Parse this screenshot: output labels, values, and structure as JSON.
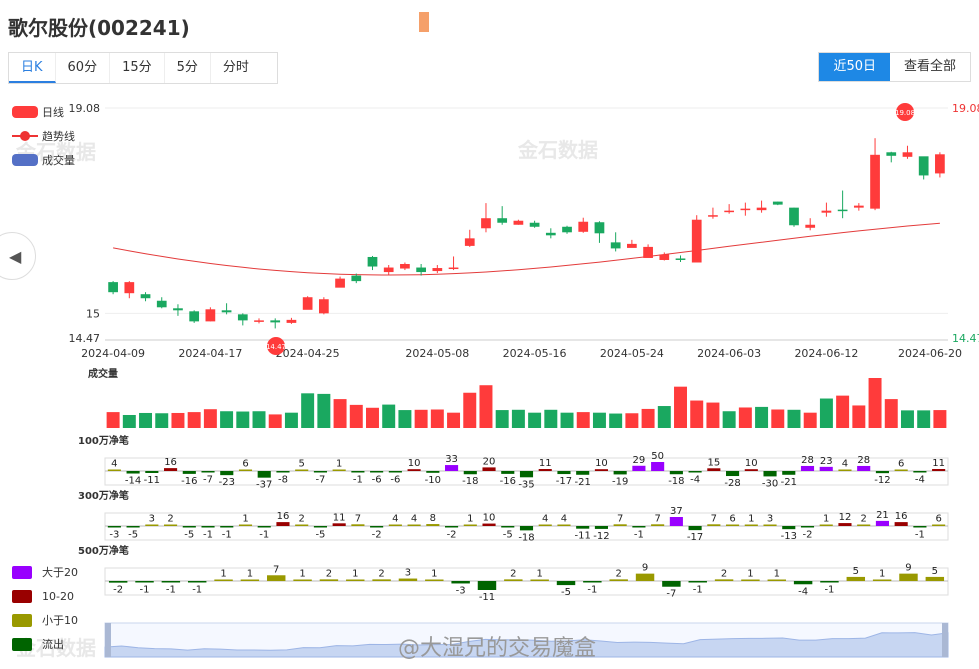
{
  "title": "歌尔股份(002241)",
  "tabs": [
    {
      "label": "日K",
      "active": true
    },
    {
      "label": "60分",
      "active": false
    },
    {
      "label": "15分",
      "active": false
    },
    {
      "label": "5分",
      "active": false
    },
    {
      "label": "分时",
      "active": false
    }
  ],
  "range_buttons": [
    {
      "label": "近50日",
      "active": true
    },
    {
      "label": "查看全部",
      "active": false
    }
  ],
  "legend": {
    "candle": "日线",
    "trend": "趋势线",
    "volume": "成交量"
  },
  "watermark": "金石数据",
  "weibo_watermark": "@大湿兄的交易魔盒",
  "nav_arrow": "◀",
  "colors": {
    "up": "#ff3b3b",
    "down": "#1aa860",
    "trend": "#e33b3b",
    "gt20": "#9900ff",
    "mid": "#990000",
    "small": "#999900",
    "out": "#006400"
  },
  "chart_data": [
    {
      "type": "candlestick",
      "title": "",
      "y_labels": {
        "top": "19.08",
        "mid": "15",
        "bottom": "14.47"
      },
      "right_labels": {
        "top": "19.08",
        "bottom": "14.47"
      },
      "ylim": [
        14.47,
        19.08
      ],
      "x_ticks": [
        "2024-04-09",
        "2024-04-17",
        "2024-04-25",
        "2024-05-08",
        "2024-05-16",
        "2024-05-24",
        "2024-06-03",
        "2024-06-12",
        "2024-06-20"
      ],
      "markers": {
        "high": "19.08",
        "low": "14.47"
      },
      "candles": [
        [
          15.62,
          15.42,
          15.38,
          15.64
        ],
        [
          15.4,
          15.62,
          15.3,
          15.64
        ],
        [
          15.38,
          15.3,
          15.24,
          15.42
        ],
        [
          15.25,
          15.12,
          15.1,
          15.32
        ],
        [
          15.1,
          15.06,
          14.95,
          15.18
        ],
        [
          15.04,
          14.84,
          14.81,
          15.06
        ],
        [
          14.84,
          15.08,
          14.84,
          15.12
        ],
        [
          15.06,
          15.02,
          14.98,
          15.2
        ],
        [
          14.98,
          14.86,
          14.76,
          15.0
        ],
        [
          14.83,
          14.86,
          14.8,
          14.9
        ],
        [
          14.86,
          14.82,
          14.7,
          14.9
        ],
        [
          14.81,
          14.87,
          14.79,
          14.91
        ],
        [
          15.07,
          15.32,
          15.3,
          15.34
        ],
        [
          15.0,
          15.28,
          14.98,
          15.32
        ],
        [
          15.51,
          15.69,
          15.52,
          15.73
        ],
        [
          15.75,
          15.64,
          15.6,
          15.79
        ],
        [
          16.12,
          15.93,
          15.86,
          16.14
        ],
        [
          15.82,
          15.91,
          15.77,
          15.96
        ],
        [
          15.89,
          15.98,
          15.86,
          16.01
        ],
        [
          15.91,
          15.82,
          15.75,
          15.98
        ],
        [
          15.84,
          15.9,
          15.8,
          15.96
        ],
        [
          15.9,
          15.91,
          15.86,
          16.13
        ],
        [
          16.34,
          16.49,
          16.32,
          16.66
        ],
        [
          16.69,
          16.89,
          16.61,
          17.19
        ],
        [
          16.89,
          16.8,
          16.76,
          17.13
        ],
        [
          16.76,
          16.84,
          16.76,
          16.86
        ],
        [
          16.8,
          16.72,
          16.7,
          16.84
        ],
        [
          16.6,
          16.55,
          16.49,
          16.69
        ],
        [
          16.72,
          16.61,
          16.58,
          16.74
        ],
        [
          16.62,
          16.82,
          16.6,
          16.9
        ],
        [
          16.81,
          16.59,
          16.4,
          16.83
        ],
        [
          16.41,
          16.29,
          16.23,
          16.61
        ],
        [
          16.3,
          16.38,
          16.32,
          16.46
        ],
        [
          16.1,
          16.32,
          16.26,
          16.37
        ],
        [
          16.06,
          16.17,
          16.05,
          16.21
        ],
        [
          16.09,
          16.06,
          16.02,
          16.15
        ],
        [
          16.01,
          16.86,
          16.01,
          16.95
        ],
        [
          16.93,
          16.95,
          16.88,
          17.1
        ],
        [
          17.02,
          17.04,
          16.98,
          17.17
        ],
        [
          17.08,
          17.08,
          16.94,
          17.2
        ],
        [
          17.05,
          17.1,
          17.0,
          17.24
        ],
        [
          17.22,
          17.16,
          17.15,
          17.22
        ],
        [
          17.1,
          16.75,
          16.72,
          17.1
        ],
        [
          16.7,
          16.76,
          16.65,
          16.89
        ],
        [
          17.0,
          17.04,
          16.92,
          17.2
        ],
        [
          17.06,
          17.04,
          16.89,
          17.44
        ],
        [
          17.1,
          17.14,
          17.04,
          17.19
        ],
        [
          17.08,
          18.15,
          17.05,
          18.48
        ],
        [
          18.2,
          18.13,
          18.0,
          18.21
        ],
        [
          18.11,
          18.2,
          18.07,
          18.33
        ],
        [
          18.12,
          17.74,
          17.66,
          18.08
        ],
        [
          17.78,
          18.16,
          17.7,
          18.2
        ]
      ],
      "trend_start": 16.3,
      "trend_end": 16.79
    },
    {
      "type": "bar",
      "title": "成交量",
      "values": [
        0.55,
        0.45,
        0.52,
        0.51,
        0.52,
        0.55,
        0.65,
        0.58,
        0.57,
        0.58,
        0.47,
        0.53,
        1.2,
        1.18,
        1.0,
        0.8,
        0.7,
        0.81,
        0.62,
        0.63,
        0.64,
        0.53,
        1.22,
        1.48,
        0.62,
        0.63,
        0.53,
        0.63,
        0.53,
        0.55,
        0.53,
        0.5,
        0.51,
        0.66,
        0.76,
        1.43,
        0.95,
        0.88,
        0.58,
        0.71,
        0.73,
        0.64,
        0.63,
        0.53,
        1.02,
        1.12,
        0.78,
        1.73,
        1.0,
        0.61,
        0.61,
        0.62
      ],
      "up": [
        1,
        0,
        0,
        0,
        1,
        1,
        1,
        0,
        0,
        0,
        1,
        0,
        0,
        0,
        1,
        1,
        1,
        0,
        0,
        1,
        1,
        1,
        1,
        1,
        0,
        0,
        0,
        0,
        0,
        1,
        0,
        0,
        1,
        1,
        0,
        1,
        1,
        1,
        0,
        1,
        0,
        1,
        0,
        1,
        0,
        1,
        1,
        1,
        1,
        0,
        0,
        1
      ]
    },
    {
      "type": "bar",
      "title": "100万净笔",
      "values": [
        4,
        -14,
        -11,
        16,
        -16,
        -7,
        -23,
        6,
        -37,
        -8,
        5,
        -7,
        1,
        -1,
        -6,
        -6,
        10,
        -10,
        33,
        -18,
        20,
        -16,
        -35,
        11,
        -17,
        -21,
        10,
        -19,
        29,
        50,
        -18,
        -4,
        15,
        -28,
        10,
        -30,
        -21,
        28,
        23,
        4,
        28,
        -12,
        6,
        -4,
        11
      ],
      "labels": [
        "4",
        "-14",
        "-11",
        "16",
        "-16",
        "-7",
        "-23",
        "6",
        "-37",
        "-8",
        "5",
        "-7",
        "1",
        "-1",
        "-6",
        "-6",
        "10",
        "-10",
        "33",
        "-18",
        "20",
        "-16",
        "-35",
        "11",
        "-17",
        "-21",
        "10",
        "-19",
        "29",
        "50",
        "-18",
        "-4",
        "15",
        "-28",
        "10",
        "-30",
        "-21",
        "28",
        "23",
        "4",
        "28",
        "-12",
        "6",
        "-4",
        "11"
      ]
    },
    {
      "type": "bar",
      "title": "300万净笔",
      "values": [
        -3,
        -5,
        3,
        2,
        -5,
        -1,
        -1,
        1,
        -1,
        16,
        2,
        -5,
        11,
        7,
        -2,
        4,
        4,
        8,
        -2,
        1,
        10,
        -5,
        -18,
        4,
        4,
        -11,
        -12,
        7,
        -1,
        7,
        37,
        -17,
        7,
        6,
        1,
        3,
        -13,
        -2,
        1,
        12,
        2,
        21,
        16,
        -1,
        6
      ],
      "labels": [
        "-3",
        "-5",
        "3",
        "2",
        "-5",
        "-1",
        "-1",
        "1",
        "-1",
        "16",
        "2",
        "-5",
        "11",
        "7",
        "-2",
        "4",
        "4",
        "8",
        "-2",
        "1",
        "10",
        "-5",
        "-18",
        "4",
        "4",
        "-11",
        "-12",
        "7",
        "-1",
        "7",
        "37",
        "-17",
        "7",
        "6",
        "1",
        "3",
        "-13",
        "-2",
        "1",
        "12",
        "2",
        "21",
        "16",
        "-1",
        "6"
      ]
    },
    {
      "type": "bar",
      "title": "500万净笔",
      "values": [
        -2,
        -1,
        -1,
        -1,
        1,
        1,
        7,
        1,
        2,
        1,
        2,
        3,
        1,
        -3,
        -11,
        2,
        1,
        -5,
        -1,
        2,
        9,
        -7,
        -1,
        2,
        1,
        1,
        -4,
        -1,
        5,
        1,
        9,
        5
      ],
      "labels": [
        "-2",
        "-1",
        "-1",
        "-1",
        "1",
        "1",
        "7",
        "1",
        "2",
        "1",
        "2",
        "3",
        "1",
        "-3",
        "-11",
        "2",
        "1",
        "-5",
        "-1",
        "2",
        "9",
        "-7",
        "-1",
        "2",
        "1",
        "1",
        "-4",
        "-1",
        "5",
        "1",
        "9",
        "5"
      ]
    }
  ],
  "flow_legend": [
    "大于20",
    "10-20",
    "小于10",
    "流出"
  ]
}
